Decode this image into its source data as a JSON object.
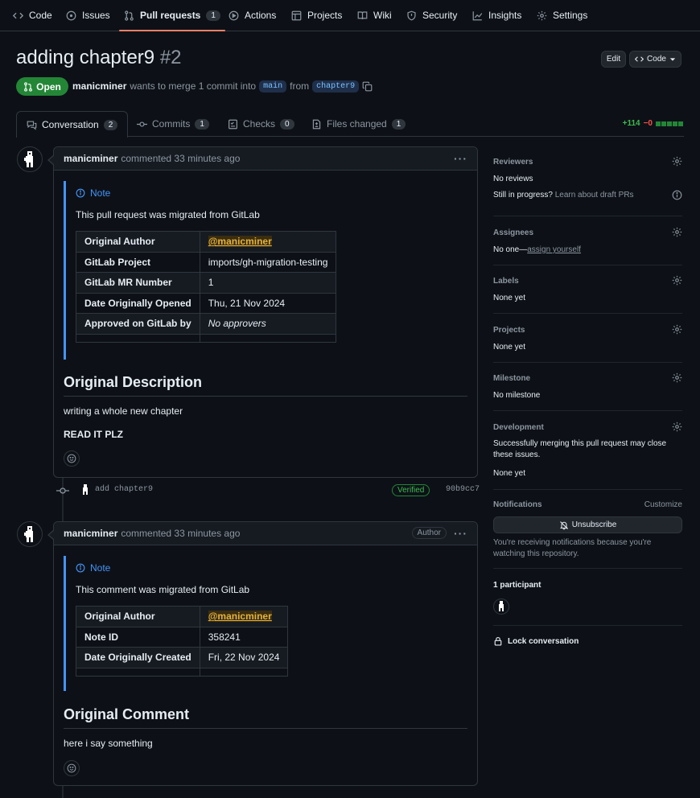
{
  "nav": {
    "items": [
      {
        "label": "Code",
        "icon": "code-icon"
      },
      {
        "label": "Issues",
        "icon": "issue-icon"
      },
      {
        "label": "Pull requests",
        "icon": "pull-request-icon",
        "count": "1"
      },
      {
        "label": "Actions",
        "icon": "play-icon"
      },
      {
        "label": "Projects",
        "icon": "table-icon"
      },
      {
        "label": "Wiki",
        "icon": "book-icon"
      },
      {
        "label": "Security",
        "icon": "shield-icon"
      },
      {
        "label": "Insights",
        "icon": "graph-icon"
      },
      {
        "label": "Settings",
        "icon": "gear-icon"
      }
    ]
  },
  "pr": {
    "title": "adding chapter9",
    "number": "#2",
    "edit_label": "Edit",
    "code_label": "Code",
    "state": "Open",
    "author": "manicminer",
    "merge_text": "wants to merge 1 commit into",
    "base_branch": "main",
    "from_text": "from",
    "head_branch": "chapter9"
  },
  "tabs": [
    {
      "label": "Conversation",
      "count": "2"
    },
    {
      "label": "Commits",
      "count": "1"
    },
    {
      "label": "Checks",
      "count": "0"
    },
    {
      "label": "Files changed",
      "count": "1"
    }
  ],
  "diffstat": {
    "additions": "+114",
    "deletions": "−0",
    "blocks": 5
  },
  "comment1": {
    "author": "manicminer",
    "action": "commented 33 minutes ago",
    "note_label": "Note",
    "note_text": "This pull request was migrated from GitLab",
    "rows": [
      {
        "key": "Original Author",
        "value": "@manicminer"
      },
      {
        "key": "GitLab Project",
        "value": "imports/gh-migration-testing"
      },
      {
        "key": "GitLab MR Number",
        "value": "1"
      },
      {
        "key": "Date Originally Opened",
        "value": "Thu, 21 Nov 2024"
      },
      {
        "key": "Approved on GitLab by",
        "value": "No approvers"
      }
    ],
    "heading": "Original Description",
    "para1": "writing a whole new chapter",
    "para2": "READ IT PLZ"
  },
  "commit": {
    "message": "add chapter9",
    "verified": "Verified",
    "sha": "90b9cc7"
  },
  "comment2": {
    "author": "manicminer",
    "action": "commented 33 minutes ago",
    "badge": "Author",
    "note_label": "Note",
    "note_text": "This comment was migrated from GitLab",
    "rows": [
      {
        "key": "Original Author",
        "value": "@manicminer"
      },
      {
        "key": "Note ID",
        "value": "358241"
      },
      {
        "key": "Date Originally Created",
        "value": "Fri, 22 Nov 2024"
      }
    ],
    "heading": "Original Comment",
    "para1": "here i say something"
  },
  "sidebar": {
    "reviewers": {
      "title": "Reviewers",
      "value": "No reviews",
      "draft_q": "Still in progress?",
      "draft_link": "Learn about draft PRs"
    },
    "assignees": {
      "title": "Assignees",
      "value": "No one—",
      "link": "assign yourself"
    },
    "labels": {
      "title": "Labels",
      "value": "None yet"
    },
    "projects": {
      "title": "Projects",
      "value": "None yet"
    },
    "milestone": {
      "title": "Milestone",
      "value": "No milestone"
    },
    "development": {
      "title": "Development",
      "line1": "Successfully merging this pull request may close",
      "line2": "these issues.",
      "value": "None yet"
    },
    "notifications": {
      "title": "Notifications",
      "customize": "Customize",
      "button": "Unsubscribe",
      "line1": "You're receiving notifications because you're",
      "line2": "watching this repository."
    },
    "participants": {
      "title": "1 participant"
    },
    "lock": {
      "label": "Lock conversation"
    }
  },
  "colors": {
    "bg": "#0d1117",
    "accent": "#4493f8",
    "open": "#238636",
    "add": "#3fb950",
    "del": "#f85149",
    "mention": "#e3b341"
  }
}
